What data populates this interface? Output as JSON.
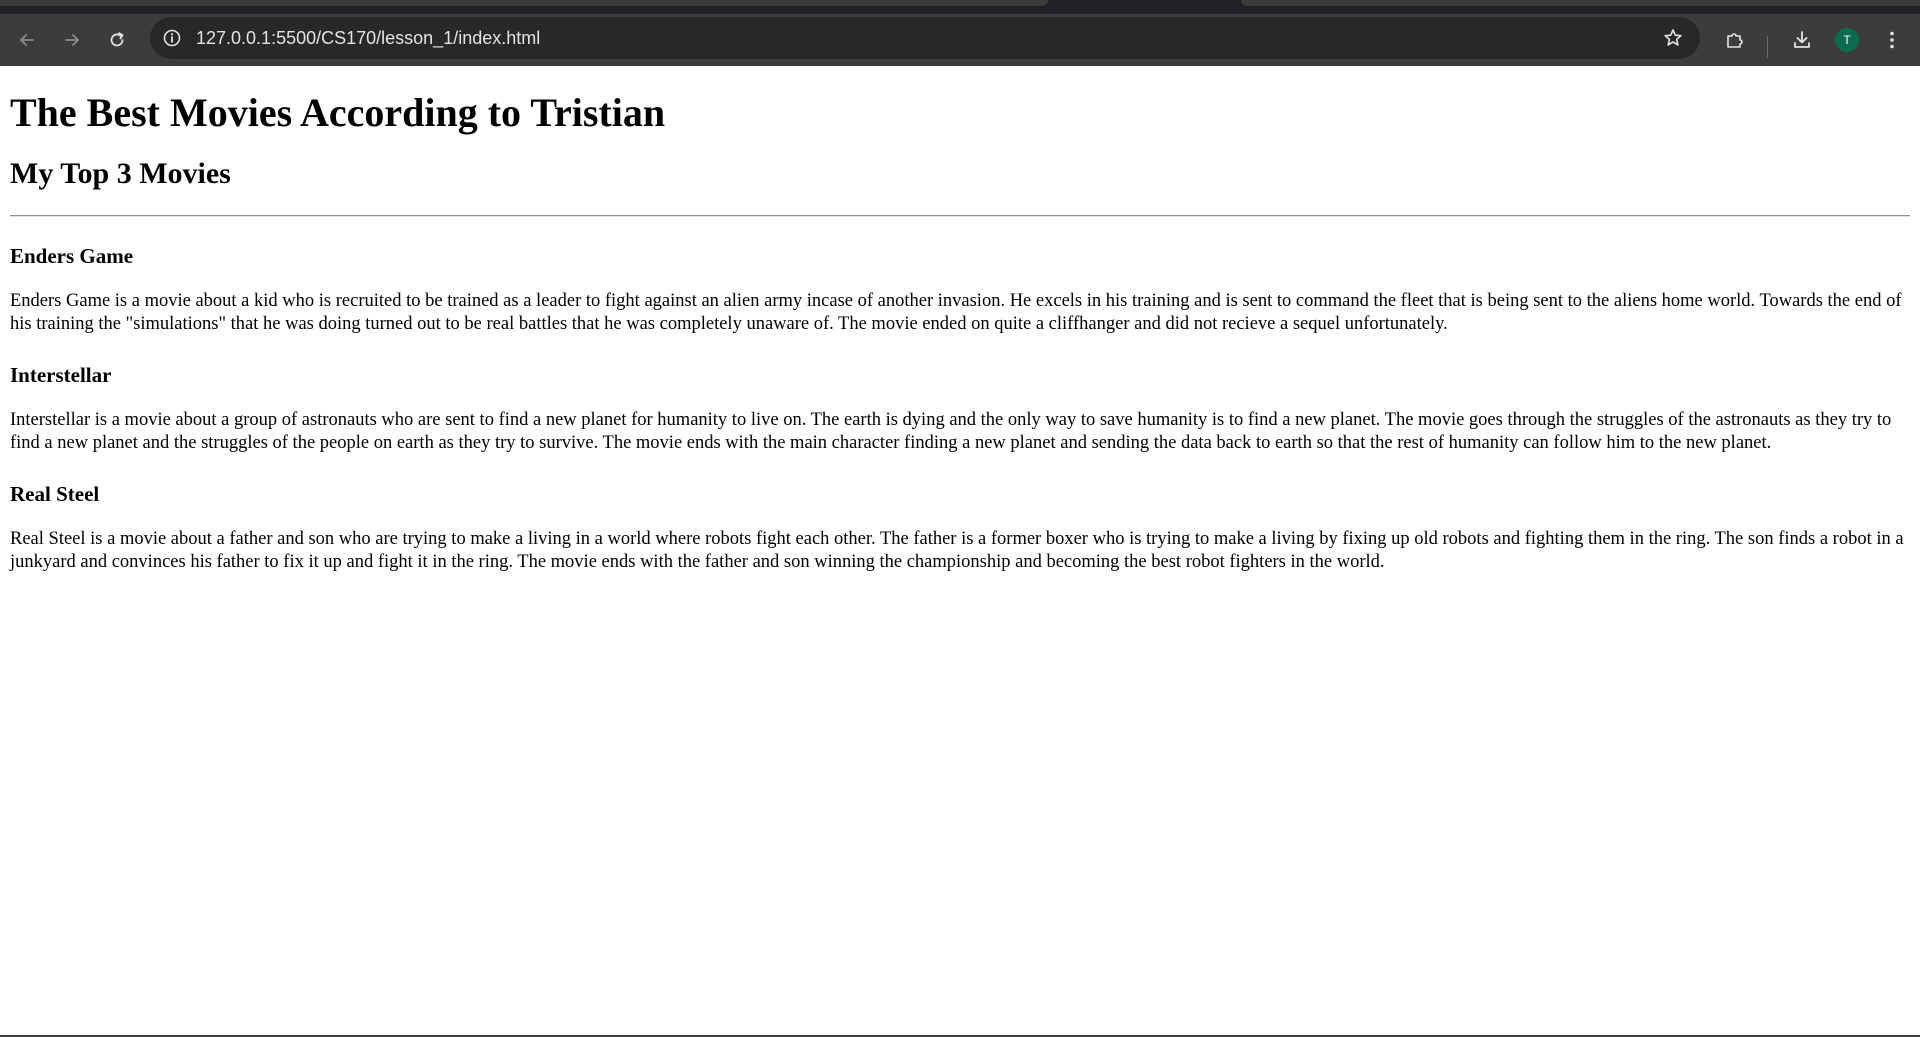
{
  "browser": {
    "url": "127.0.0.1:5500/CS170/lesson_1/index.html",
    "profile_initial": "T",
    "icons": {
      "back": "arrow-left-icon",
      "forward": "arrow-right-icon",
      "reload": "reload-icon",
      "site_info": "info-icon",
      "bookmark": "star-icon",
      "extensions": "puzzle-icon",
      "downloads": "download-icon",
      "menu": "kebab-menu-icon"
    },
    "colors": {
      "chrome": "#3c3c3c",
      "omnibox": "#282828",
      "avatar": "#0b6b4f"
    }
  },
  "page": {
    "title": "The Best Movies According to Tristian",
    "subtitle": "My Top 3 Movies",
    "movies": [
      {
        "title": "Enders Game",
        "description": "Enders Game is a movie about a kid who is recruited to be trained as a leader to fight against an alien army incase of another invasion. He excels in his training and is sent to command the fleet that is being sent to the aliens home world. Towards the end of his training the \"simulations\" that he was doing turned out to be real battles that he was completely unaware of. The movie ended on quite a cliffhanger and did not recieve a sequel unfortunately."
      },
      {
        "title": "Interstellar",
        "description": "Interstellar is a movie about a group of astronauts who are sent to find a new planet for humanity to live on. The earth is dying and the only way to save humanity is to find a new planet. The movie goes through the struggles of the astronauts as they try to find a new planet and the struggles of the people on earth as they try to survive. The movie ends with the main character finding a new planet and sending the data back to earth so that the rest of humanity can follow him to the new planet."
      },
      {
        "title": "Real Steel",
        "description": "Real Steel is a movie about a father and son who are trying to make a living in a world where robots fight each other. The father is a former boxer who is trying to make a living by fixing up old robots and fighting them in the ring. The son finds a robot in a junkyard and convinces his father to fix it up and fight it in the ring. The movie ends with the father and son winning the championship and becoming the best robot fighters in the world."
      }
    ]
  }
}
